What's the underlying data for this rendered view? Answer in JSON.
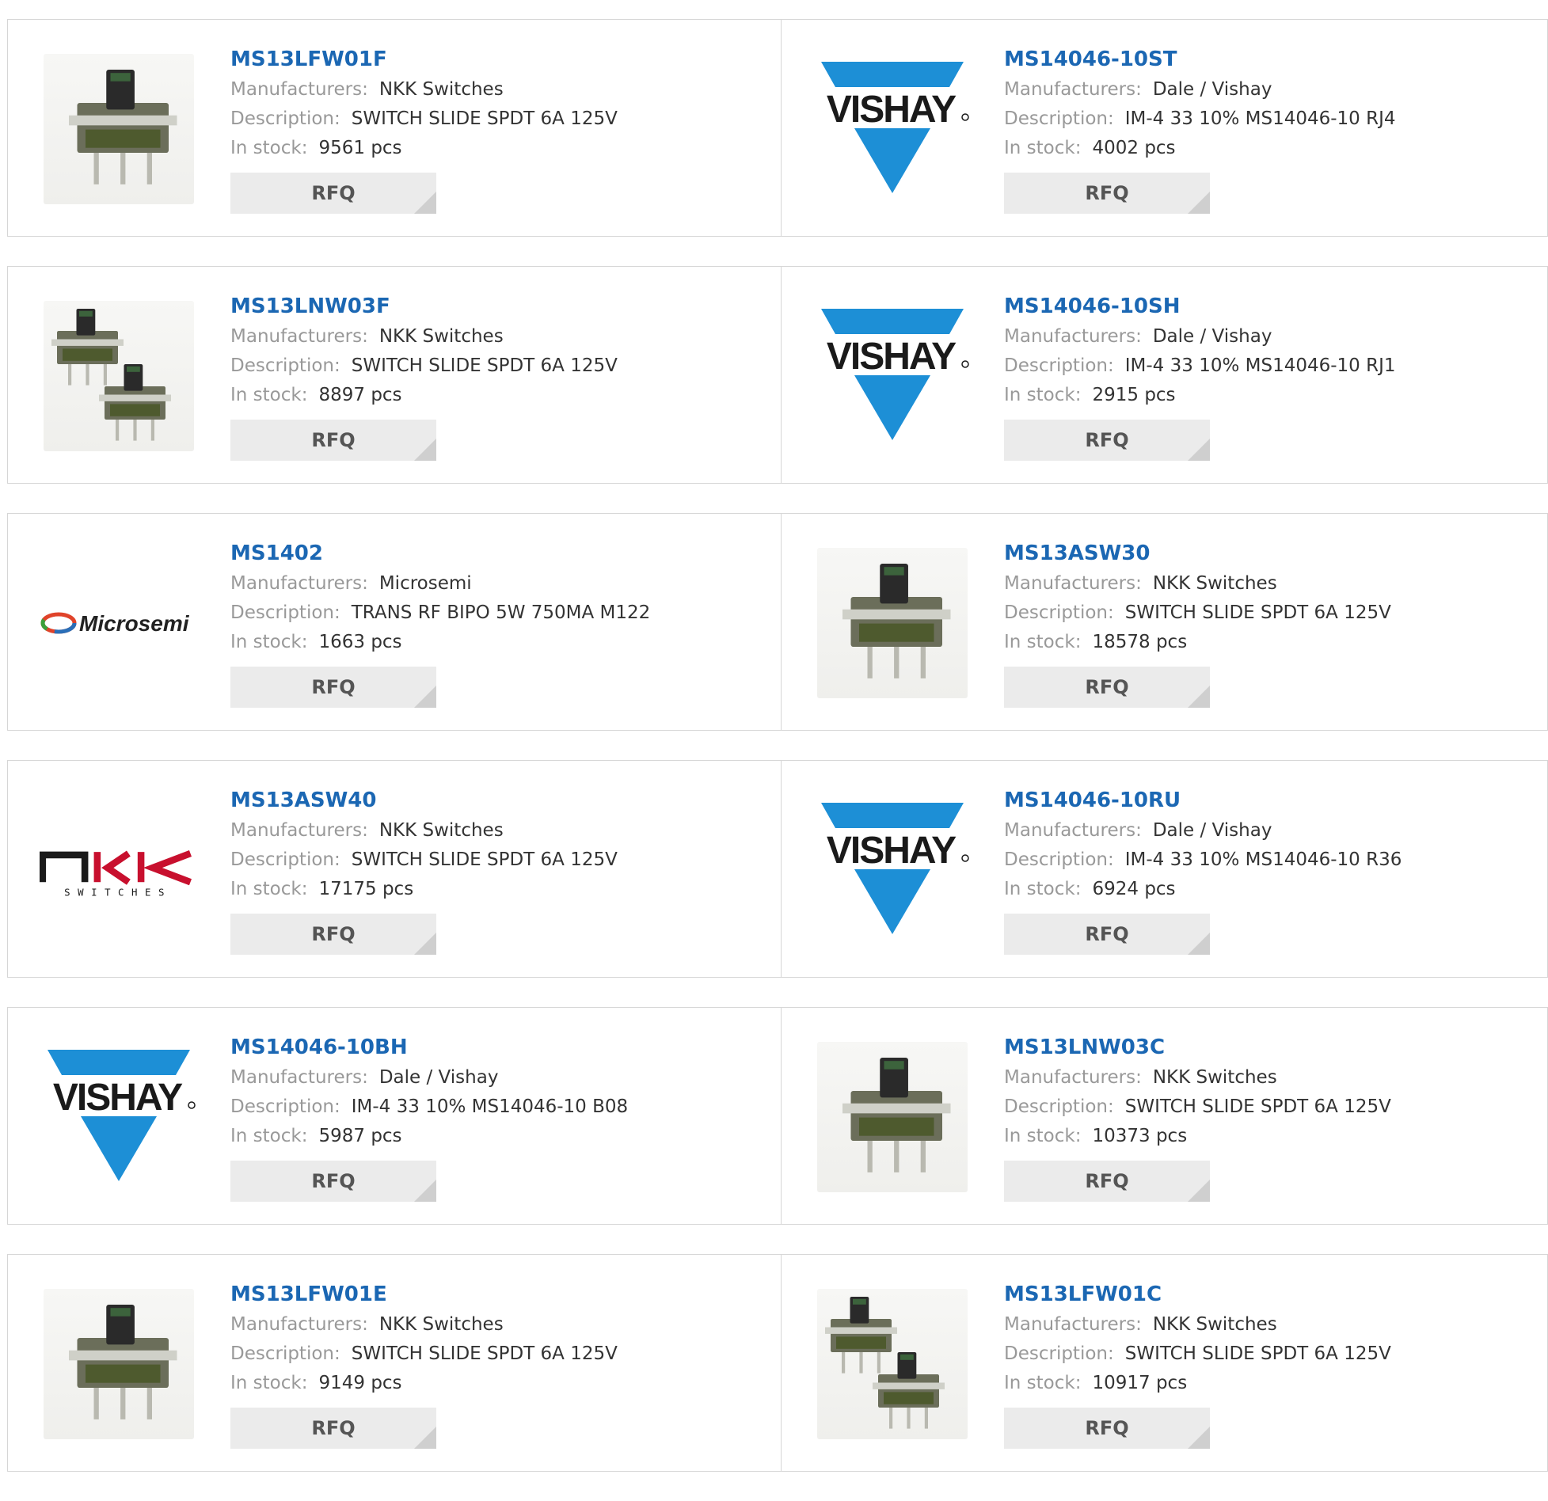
{
  "labels": {
    "manufacturers": "Manufacturers:",
    "description": "Description:",
    "in_stock": "In stock:",
    "rfq": "RFQ"
  },
  "colors": {
    "part_link": "#1b67b3",
    "vishay_blue": "#1d8fd6",
    "button_bg": "#ebebeb"
  },
  "products": [
    {
      "part": "MS13LFW01F",
      "manufacturer": "NKK Switches",
      "description": "SWITCH SLIDE SPDT 6A 125V",
      "stock": "9561 pcs",
      "image": "switch-photo-icon"
    },
    {
      "part": "MS14046-10ST",
      "manufacturer": "Dale / Vishay",
      "description": "IM-4 33 10% MS14046-10 RJ4",
      "stock": "4002 pcs",
      "image": "vishay-logo-icon"
    },
    {
      "part": "MS13LNW03F",
      "manufacturer": "NKK Switches",
      "description": "SWITCH SLIDE SPDT 6A 125V",
      "stock": "8897 pcs",
      "image": "switch-pair-photo-icon"
    },
    {
      "part": "MS14046-10SH",
      "manufacturer": "Dale / Vishay",
      "description": "IM-4 33 10% MS14046-10 RJ1",
      "stock": "2915 pcs",
      "image": "vishay-logo-icon"
    },
    {
      "part": "MS1402",
      "manufacturer": "Microsemi",
      "description": "TRANS RF BIPO 5W 750MA M122",
      "stock": "1663 pcs",
      "image": "microsemi-logo-icon"
    },
    {
      "part": "MS13ASW30",
      "manufacturer": "NKK Switches",
      "description": "SWITCH SLIDE SPDT 6A 125V",
      "stock": "18578 pcs",
      "image": "switch-photo-icon"
    },
    {
      "part": "MS13ASW40",
      "manufacturer": "NKK Switches",
      "description": "SWITCH SLIDE SPDT 6A 125V",
      "stock": "17175 pcs",
      "image": "nkk-logo-icon"
    },
    {
      "part": "MS14046-10RU",
      "manufacturer": "Dale / Vishay",
      "description": "IM-4 33 10% MS14046-10 R36",
      "stock": "6924 pcs",
      "image": "vishay-logo-icon"
    },
    {
      "part": "MS14046-10BH",
      "manufacturer": "Dale / Vishay",
      "description": "IM-4 33 10% MS14046-10 B08",
      "stock": "5987 pcs",
      "image": "vishay-logo-icon"
    },
    {
      "part": "MS13LNW03C",
      "manufacturer": "NKK Switches",
      "description": "SWITCH SLIDE SPDT 6A 125V",
      "stock": "10373 pcs",
      "image": "switch-photo-icon"
    },
    {
      "part": "MS13LFW01E",
      "manufacturer": "NKK Switches",
      "description": "SWITCH SLIDE SPDT 6A 125V",
      "stock": "9149 pcs",
      "image": "switch-photo-icon"
    },
    {
      "part": "MS13LFW01C",
      "manufacturer": "NKK Switches",
      "description": "SWITCH SLIDE SPDT 6A 125V",
      "stock": "10917 pcs",
      "image": "switch-pair-photo-icon"
    }
  ],
  "logos": {
    "vishay": "VISHAY.",
    "microsemi": "Microsemi",
    "nkk_top": "nkk",
    "nkk_bottom": "SWITCHES"
  }
}
